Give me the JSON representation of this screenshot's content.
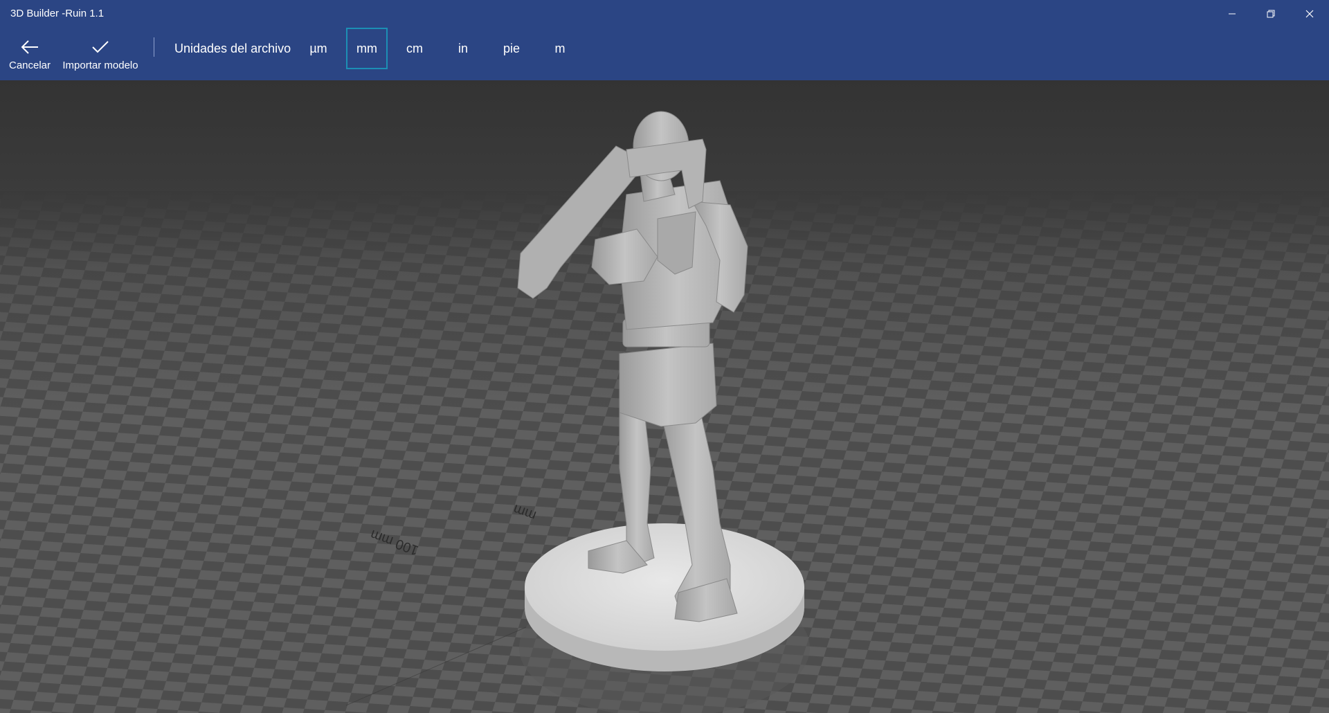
{
  "window": {
    "title": "3D Builder -Ruin 1.1",
    "controls": [
      "minimize-icon",
      "restore-icon",
      "close-icon"
    ]
  },
  "toolbar": {
    "cancel_label": "Cancelar",
    "import_label": "Importar modelo",
    "units_label": "Unidades del archivo",
    "units": [
      "µm",
      "mm",
      "cm",
      "in",
      "pie",
      "m"
    ],
    "selected_unit": "mm"
  },
  "viewport": {
    "ruler_label_near": "100 mm",
    "ruler_label_far": "mm",
    "colors": {
      "background_top": "#363636",
      "floor_dark": "#4a4a4a",
      "floor_light": "#5e5e5e",
      "model": "#bdbdbd",
      "base": "#dcdcdc"
    }
  }
}
